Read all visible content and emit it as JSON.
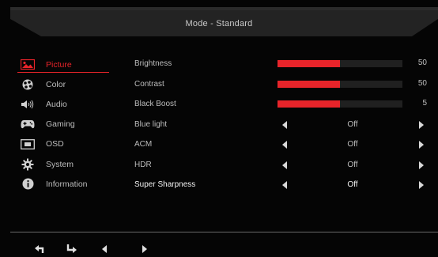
{
  "header": {
    "title": "Mode - Standard"
  },
  "menu": [
    {
      "label": "Picture",
      "icon": "picture-icon",
      "active": true
    },
    {
      "label": "Color",
      "icon": "color-palette-icon",
      "active": false
    },
    {
      "label": "Audio",
      "icon": "speaker-icon",
      "active": false
    },
    {
      "label": "Gaming",
      "icon": "gamepad-icon",
      "active": false
    },
    {
      "label": "OSD",
      "icon": "osd-window-icon",
      "active": false
    },
    {
      "label": "System",
      "icon": "system-gear-icon",
      "active": false
    },
    {
      "label": "Information",
      "icon": "info-icon",
      "active": false
    }
  ],
  "settings": [
    {
      "label": "Brightness",
      "type": "slider",
      "value": "50",
      "level": 0.5
    },
    {
      "label": "Contrast",
      "type": "slider",
      "value": "50",
      "level": 0.5
    },
    {
      "label": "Black Boost",
      "type": "slider",
      "value": "5",
      "level": 0.5
    },
    {
      "label": "Blue light",
      "type": "option",
      "value": "Off"
    },
    {
      "label": "ACM",
      "type": "option",
      "value": "Off"
    },
    {
      "label": "HDR",
      "type": "option",
      "value": "Off"
    },
    {
      "label": "Super Sharpness",
      "type": "option",
      "value": "Off",
      "active": true
    }
  ],
  "footer": {
    "buttons": [
      "back-icon",
      "enter-icon",
      "left-arrow-icon",
      "right-arrow-icon"
    ]
  },
  "colors": {
    "accent": "#e8242a",
    "background": "#050505",
    "header": "#232323"
  }
}
